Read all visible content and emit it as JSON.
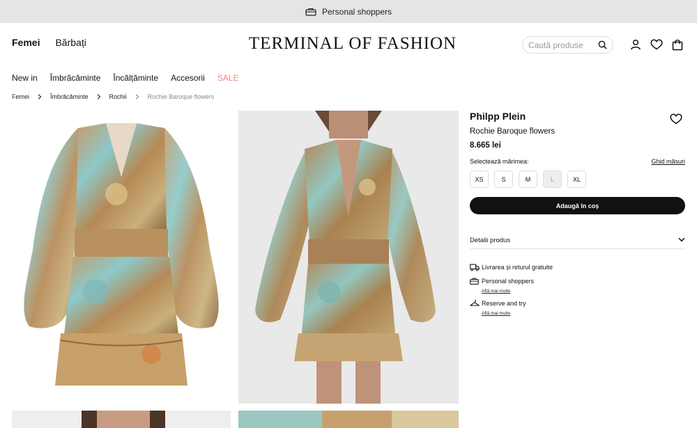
{
  "topbar": {
    "text": "Personal shoppers",
    "icon": "shopping-bag-icon"
  },
  "header": {
    "gender": [
      "Femei",
      "Bărbați"
    ],
    "logo": "TERMINAL OF FASHION",
    "search_placeholder": "Caută produse",
    "icons": [
      "user-icon",
      "heart-icon",
      "cart-icon"
    ]
  },
  "nav": {
    "categories": [
      "New in",
      "Îmbrăcăminte",
      "Încălțăminte",
      "Accesorii"
    ],
    "sale": "SALE",
    "sale_color": "#e88a88"
  },
  "breadcrumb": [
    "Femei",
    "Îmbrăcăminte",
    "Rochii",
    "Rochie Baroque flowers"
  ],
  "product": {
    "brand": "Philpp Plein",
    "name": "Rochie Baroque flowers",
    "price": "8.665 lei",
    "size_label": "Selectează mărimea:",
    "size_guide": "Ghid măsuri",
    "sizes": [
      {
        "label": "XS",
        "available": true
      },
      {
        "label": "S",
        "available": true
      },
      {
        "label": "M",
        "available": true
      },
      {
        "label": "L",
        "available": false
      },
      {
        "label": "XL",
        "available": true
      }
    ],
    "add_to_cart": "Adaugă în coș",
    "details": "Detalii produs",
    "features": [
      {
        "icon": "truck-icon",
        "text": "Livrarea și returul gratuite",
        "link": ""
      },
      {
        "icon": "shopping-bag-icon",
        "text": "Personal shoppers",
        "link": "Află mai multe"
      },
      {
        "icon": "hanger-icon",
        "text": "Reserve and try",
        "link": "Află mai multe"
      }
    ]
  },
  "colors": {
    "topbar_bg": "#e5e5e5",
    "button_bg": "#111111",
    "accent_sale": "#e88a88"
  }
}
